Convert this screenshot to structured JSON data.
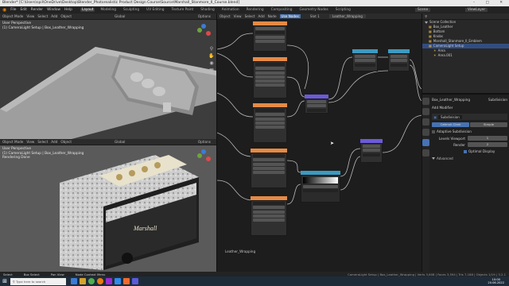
{
  "window": {
    "title": "Blender* [C:\\Users\\spil\\OneDrive\\Desktop\\Blender_Photorealistic Product Design Course\\Source\\Marshall_Stanmore_II_Course.blend]",
    "controls": "– □ ✕"
  },
  "menu": [
    "File",
    "Edit",
    "Render",
    "Window",
    "Help"
  ],
  "workspaces": [
    "Layout",
    "Modeling",
    "Sculpting",
    "UV Editing",
    "Texture Paint",
    "Shading",
    "Animation",
    "Rendering",
    "Compositing",
    "Geometry Nodes",
    "Scripting"
  ],
  "active_workspace": "Layout",
  "scene_label": "Scene",
  "view_layer_label": "ViewLayer",
  "viewport_top": {
    "header": [
      "Object Mode",
      "View",
      "Select",
      "Add",
      "Object",
      "Global",
      "Options"
    ],
    "info": [
      "User Perspective",
      "(1) CameraLight Setup | Box_Leather_Wrapping"
    ]
  },
  "viewport_bottom": {
    "header": [
      "Object Mode",
      "View",
      "Select",
      "Add",
      "Object",
      "Global",
      "Options"
    ],
    "info": [
      "User Perspective",
      "(1) CameraLight Setup | Box_Leather_Wrapping",
      "Rendering Done"
    ]
  },
  "node_editor": {
    "header": [
      "Object",
      "View",
      "Select",
      "Add",
      "Node",
      "Use Nodes",
      "Slot 1",
      "Leather_Wrapping"
    ],
    "frame_label": "Leather_Wrapping"
  },
  "outliner": {
    "title": "Scene Collection",
    "items": [
      {
        "label": "Scene Collection",
        "depth": 0
      },
      {
        "label": "Box_Leather",
        "depth": 1
      },
      {
        "label": "Bottom",
        "depth": 1
      },
      {
        "label": "Knobs",
        "depth": 1
      },
      {
        "label": "Marshall_Stanmore_II_Emblem",
        "depth": 1
      },
      {
        "label": "CameraLight Setup",
        "depth": 1
      },
      {
        "label": "Area",
        "depth": 2
      },
      {
        "label": "Area.001",
        "depth": 2
      }
    ]
  },
  "properties": {
    "object_name": "Box_Leather_Wrapping",
    "modifier_label": "Subdivision",
    "add_modifier": "Add Modifier",
    "modifier_name": "Subdivision",
    "tabs": [
      "Catmull-Clark",
      "Simple"
    ],
    "fields": [
      {
        "label": "Levels Viewport",
        "value": "1"
      },
      {
        "label": "Render",
        "value": "2"
      }
    ],
    "checks": [
      "Adaptive Subdivision",
      "Optimal Display"
    ],
    "advanced": "Advanced"
  },
  "statusbar": {
    "left": [
      "Select",
      "Box Select",
      "Pan View",
      "Node Context Menu"
    ],
    "right": "CameraLight Setup | Box_Leather_Wrapping | Verts 3,608 | Faces 3,594 | Tris 7,188 | Objects 1/19 | 3.2.1"
  },
  "taskbar": {
    "search": "Type here to search",
    "time": "10:00",
    "date": "20.06.2022"
  },
  "colors": {
    "accent": "#4772b3",
    "header": "#2b2b2b",
    "node_bg": "#1d1d1d",
    "viewport": "#3d3d3d",
    "texture_header": "#e58a45",
    "vector_header": "#6b5ad9",
    "converter_header": "#3d9ac1"
  }
}
